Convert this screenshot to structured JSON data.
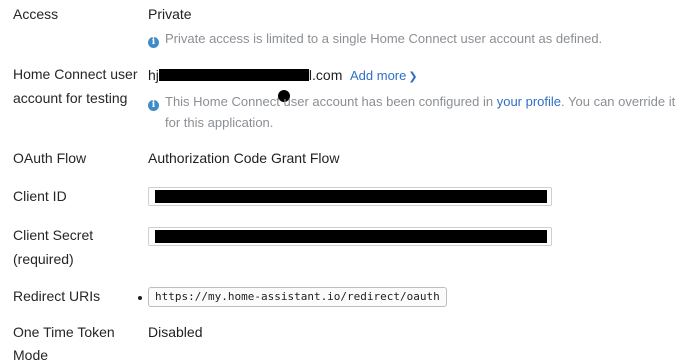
{
  "access": {
    "label": "Access",
    "value": "Private",
    "info": "Private access is limited to a single Home Connect user account as defined."
  },
  "test_account": {
    "label_line1": "Home Connect user",
    "label_line2": "account for testing",
    "email_prefix": "hj",
    "email_suffix": "l.com",
    "add_more": "Add more",
    "info_part1": "This Home Connect",
    "info_part2": "user account has been configured in ",
    "info_link": "your profile",
    "info_part3": ". You can override it",
    "info_line2": "for this application."
  },
  "oauth": {
    "label": "OAuth Flow",
    "value": "Authorization Code Grant Flow"
  },
  "client_id": {
    "label": "Client ID"
  },
  "client_secret": {
    "label_line1": "Client Secret",
    "label_line2": "(required)"
  },
  "redirect": {
    "label": "Redirect URIs",
    "uri": "https://my.home-assistant.io/redirect/oauth"
  },
  "one_time_token": {
    "label_line1": "One Time Token",
    "label_line2": "Mode",
    "value": "Disabled"
  },
  "colors": {
    "link": "#2f6fc5",
    "info_icon": "#3f8bc9",
    "muted_text": "#8b8f94"
  }
}
